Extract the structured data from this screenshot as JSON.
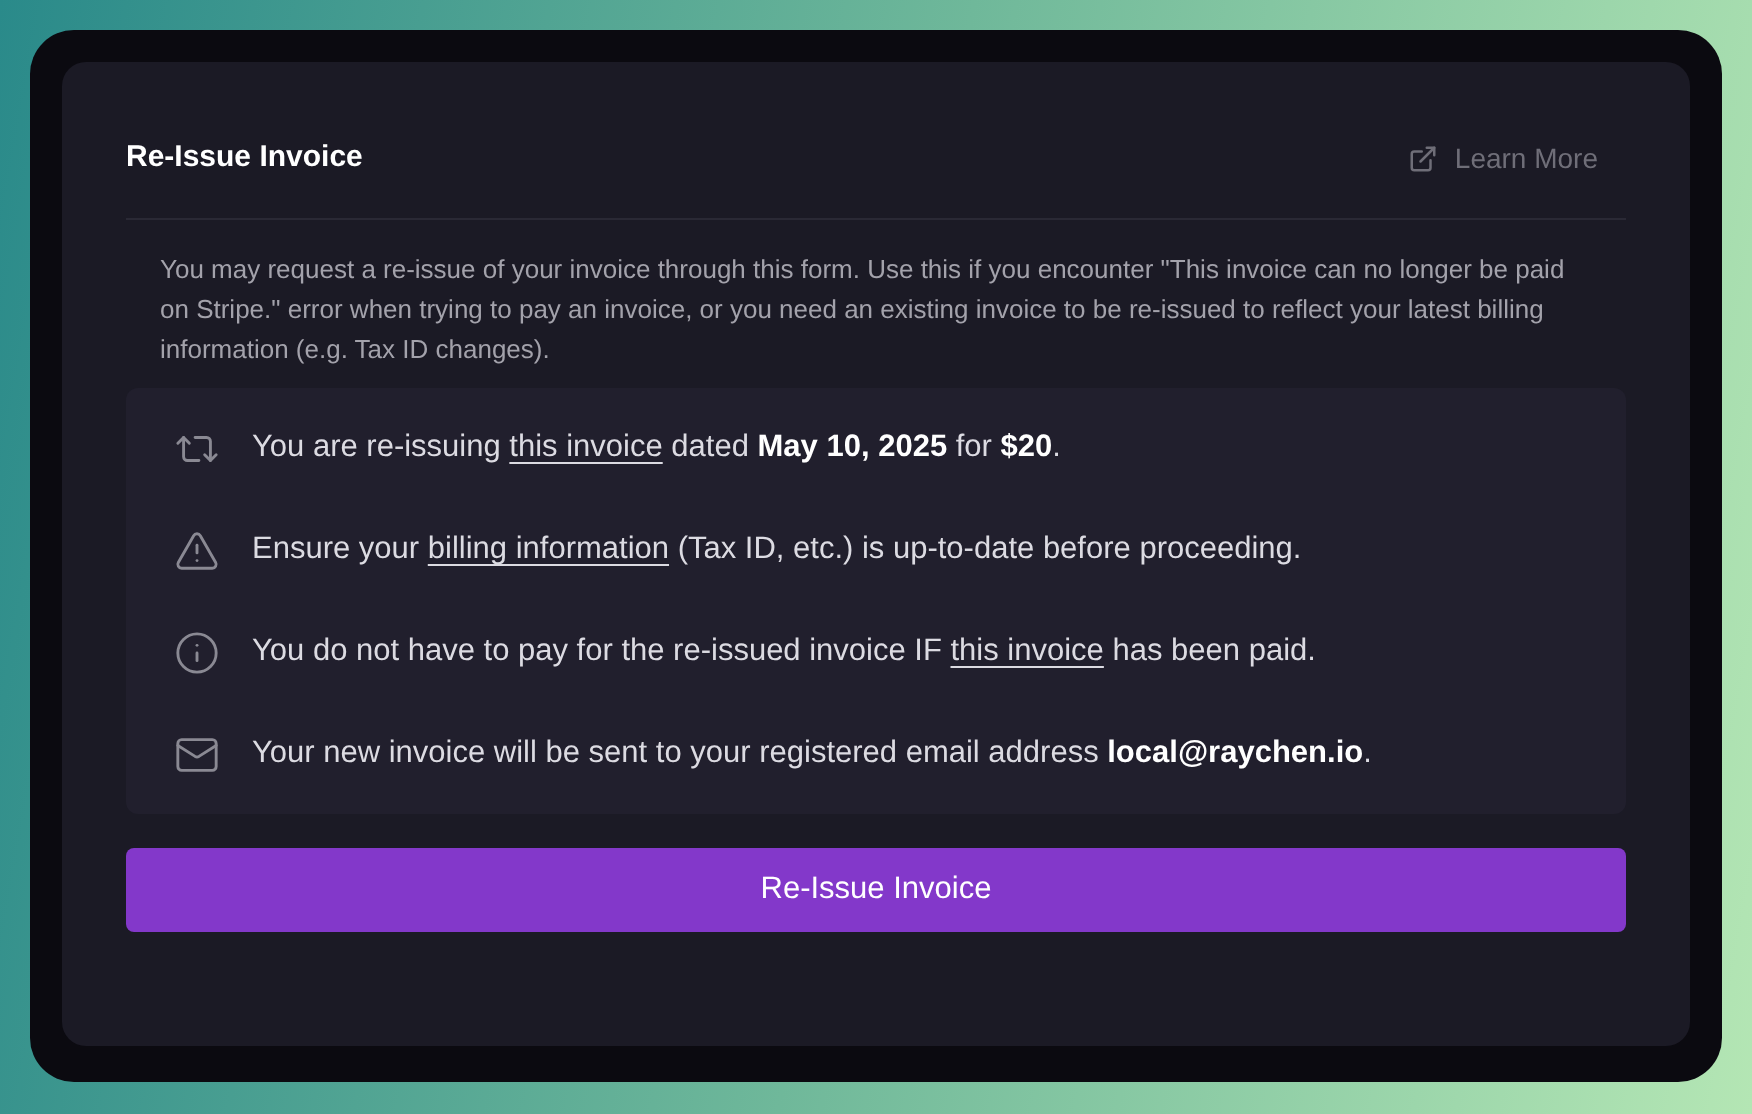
{
  "dialog": {
    "title": "Re-Issue Invoice",
    "learn_more": "Learn More",
    "description": "You may request a re-issue of your invoice through this form. Use this if you encounter \"This invoice can no longer be paid on Stripe.\" error when trying to pay an invoice, or you need an existing invoice to be re-issued to reflect your latest billing information (e.g. Tax ID changes).",
    "notes": [
      {
        "kind": "reissue",
        "parts": [
          {
            "kind": "plain",
            "text": "You are re-issuing "
          },
          {
            "kind": "link",
            "text": "this invoice"
          },
          {
            "kind": "plain",
            "text": " dated "
          },
          {
            "kind": "bold",
            "text": "May 10, 2025"
          },
          {
            "kind": "plain",
            "text": " for "
          },
          {
            "kind": "bold",
            "text": "$20"
          },
          {
            "kind": "plain",
            "text": "."
          }
        ]
      },
      {
        "kind": "warning",
        "parts": [
          {
            "kind": "plain",
            "text": "Ensure your "
          },
          {
            "kind": "link",
            "text": "billing information"
          },
          {
            "kind": "plain",
            "text": " (Tax ID, etc.) is up-to-date before proceeding."
          }
        ]
      },
      {
        "kind": "info",
        "parts": [
          {
            "kind": "plain",
            "text": "You do not have to pay for the re-issued invoice IF "
          },
          {
            "kind": "link",
            "text": "this invoice"
          },
          {
            "kind": "plain",
            "text": " has been paid."
          }
        ]
      },
      {
        "kind": "email",
        "parts": [
          {
            "kind": "plain",
            "text": "Your new invoice will be sent to your registered email address "
          },
          {
            "kind": "bold",
            "text": "local@raychen.io"
          },
          {
            "kind": "plain",
            "text": "."
          }
        ]
      }
    ],
    "submit": "Re-Issue Invoice"
  }
}
